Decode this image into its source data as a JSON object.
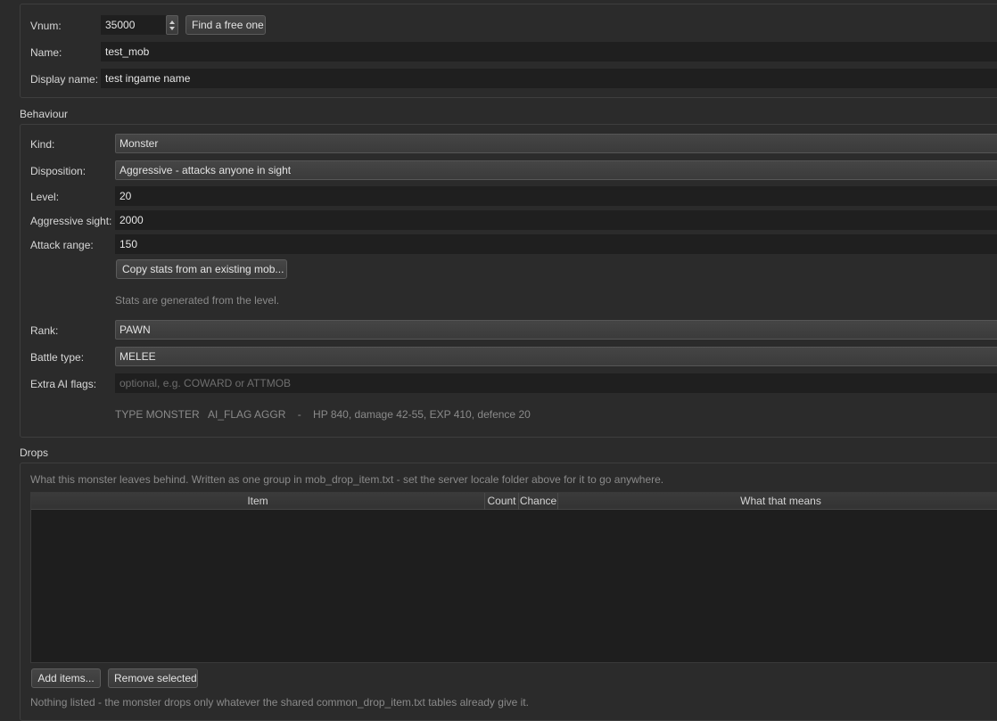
{
  "identity": {
    "vnum_label": "Vnum:",
    "vnum_value": "35000",
    "find_free_button": "Find a free one",
    "name_label": "Name:",
    "name_value": "test_mob",
    "display_name_label": "Display name:",
    "display_name_value": "test ingame name"
  },
  "behaviour": {
    "title": "Behaviour",
    "kind_label": "Kind:",
    "kind_value": "Monster",
    "disposition_label": "Disposition:",
    "disposition_value": "Aggressive - attacks anyone in sight",
    "level_label": "Level:",
    "level_value": "20",
    "aggressive_sight_label": "Aggressive sight:",
    "aggressive_sight_value": "2000",
    "attack_range_label": "Attack range:",
    "attack_range_value": "150",
    "copy_stats_button": "Copy stats from an existing mob...",
    "stats_hint": "Stats are generated from the level.",
    "rank_label": "Rank:",
    "rank_value": "PAWN",
    "battle_type_label": "Battle type:",
    "battle_type_value": "MELEE",
    "extra_ai_flags_label": "Extra AI flags:",
    "extra_ai_flags_placeholder": "optional, e.g. COWARD or ATTMOB",
    "summary": "TYPE MONSTER   AI_FLAG AGGR    -    HP 840, damage 42-55, EXP 410, defence 20"
  },
  "drops": {
    "title": "Drops",
    "description": "What this monster leaves behind. Written as one group in mob_drop_item.txt - set the server locale folder above for it to go anywhere.",
    "columns": [
      "Item",
      "Count",
      "Chance",
      "What that means"
    ],
    "rows": [],
    "add_items_button": "Add items...",
    "remove_selected_button": "Remove selected",
    "empty_note": "Nothing listed - the monster drops only whatever the shared common_drop_item.txt tables already give it."
  }
}
